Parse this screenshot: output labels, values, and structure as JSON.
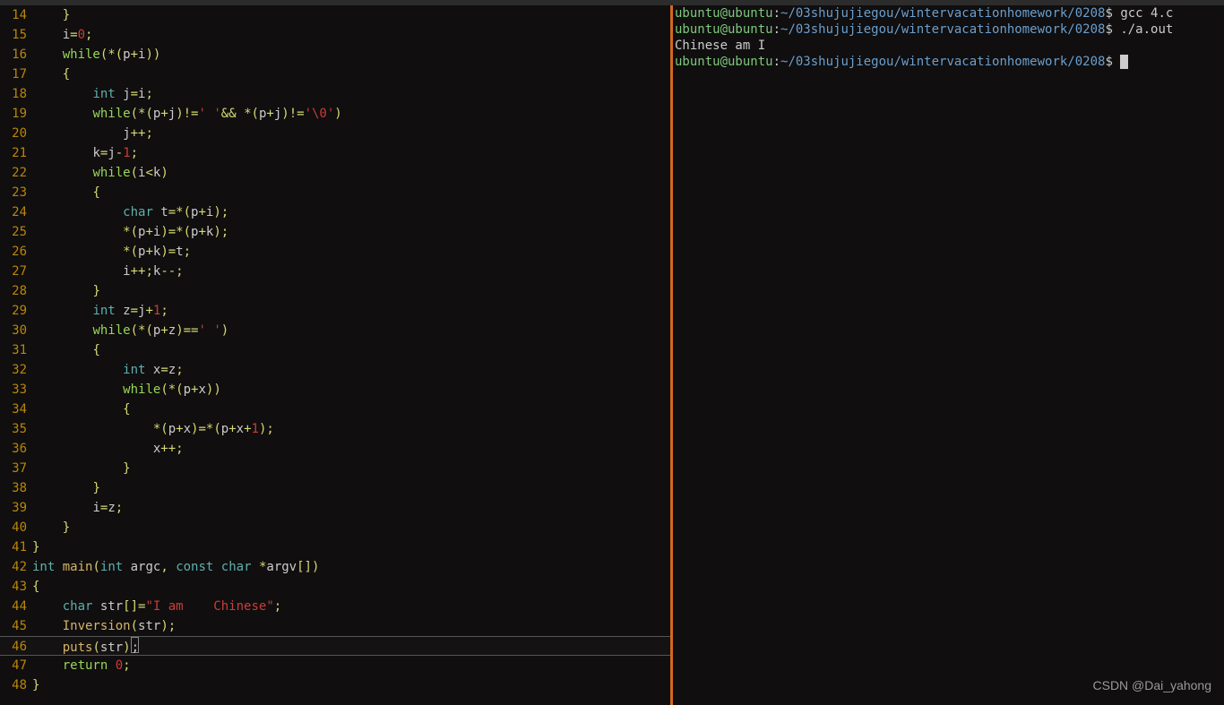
{
  "editor": {
    "lines": [
      {
        "num": 14,
        "indent": 4,
        "tokens": [
          {
            "t": "op",
            "v": "}"
          }
        ]
      },
      {
        "num": 15,
        "indent": 4,
        "tokens": [
          {
            "t": "ident",
            "v": "i"
          },
          {
            "t": "op",
            "v": "="
          },
          {
            "t": "num",
            "v": "0"
          },
          {
            "t": "op",
            "v": ";"
          }
        ]
      },
      {
        "num": 16,
        "indent": 4,
        "tokens": [
          {
            "t": "kw",
            "v": "while"
          },
          {
            "t": "op",
            "v": "(*("
          },
          {
            "t": "ident",
            "v": "p"
          },
          {
            "t": "op",
            "v": "+"
          },
          {
            "t": "ident",
            "v": "i"
          },
          {
            "t": "op",
            "v": "))"
          }
        ]
      },
      {
        "num": 17,
        "indent": 4,
        "tokens": [
          {
            "t": "op",
            "v": "{"
          }
        ]
      },
      {
        "num": 18,
        "indent": 8,
        "tokens": [
          {
            "t": "type",
            "v": "int"
          },
          {
            "t": "ident",
            "v": " j"
          },
          {
            "t": "op",
            "v": "="
          },
          {
            "t": "ident",
            "v": "i"
          },
          {
            "t": "op",
            "v": ";"
          }
        ]
      },
      {
        "num": 19,
        "indent": 8,
        "tokens": [
          {
            "t": "kw",
            "v": "while"
          },
          {
            "t": "op",
            "v": "(*("
          },
          {
            "t": "ident",
            "v": "p"
          },
          {
            "t": "op",
            "v": "+"
          },
          {
            "t": "ident",
            "v": "j"
          },
          {
            "t": "op",
            "v": ")!="
          },
          {
            "t": "str",
            "v": "' '"
          },
          {
            "t": "op",
            "v": "&& *("
          },
          {
            "t": "ident",
            "v": "p"
          },
          {
            "t": "op",
            "v": "+"
          },
          {
            "t": "ident",
            "v": "j"
          },
          {
            "t": "op",
            "v": ")!="
          },
          {
            "t": "str",
            "v": "'\\0'"
          },
          {
            "t": "op",
            "v": ")"
          }
        ]
      },
      {
        "num": 20,
        "indent": 12,
        "tokens": [
          {
            "t": "ident",
            "v": "j"
          },
          {
            "t": "op",
            "v": "++;"
          }
        ]
      },
      {
        "num": 21,
        "indent": 8,
        "tokens": [
          {
            "t": "ident",
            "v": "k"
          },
          {
            "t": "op",
            "v": "="
          },
          {
            "t": "ident",
            "v": "j"
          },
          {
            "t": "op",
            "v": "-"
          },
          {
            "t": "num",
            "v": "1"
          },
          {
            "t": "op",
            "v": ";"
          }
        ]
      },
      {
        "num": 22,
        "indent": 8,
        "tokens": [
          {
            "t": "kw",
            "v": "while"
          },
          {
            "t": "op",
            "v": "("
          },
          {
            "t": "ident",
            "v": "i"
          },
          {
            "t": "op",
            "v": "<"
          },
          {
            "t": "ident",
            "v": "k"
          },
          {
            "t": "op",
            "v": ")"
          }
        ]
      },
      {
        "num": 23,
        "indent": 8,
        "tokens": [
          {
            "t": "op",
            "v": "{"
          }
        ]
      },
      {
        "num": 24,
        "indent": 12,
        "tokens": [
          {
            "t": "type",
            "v": "char"
          },
          {
            "t": "ident",
            "v": " t"
          },
          {
            "t": "op",
            "v": "=*("
          },
          {
            "t": "ident",
            "v": "p"
          },
          {
            "t": "op",
            "v": "+"
          },
          {
            "t": "ident",
            "v": "i"
          },
          {
            "t": "op",
            "v": ");"
          }
        ]
      },
      {
        "num": 25,
        "indent": 12,
        "tokens": [
          {
            "t": "op",
            "v": "*("
          },
          {
            "t": "ident",
            "v": "p"
          },
          {
            "t": "op",
            "v": "+"
          },
          {
            "t": "ident",
            "v": "i"
          },
          {
            "t": "op",
            "v": ")=*("
          },
          {
            "t": "ident",
            "v": "p"
          },
          {
            "t": "op",
            "v": "+"
          },
          {
            "t": "ident",
            "v": "k"
          },
          {
            "t": "op",
            "v": ");"
          }
        ]
      },
      {
        "num": 26,
        "indent": 12,
        "tokens": [
          {
            "t": "op",
            "v": "*("
          },
          {
            "t": "ident",
            "v": "p"
          },
          {
            "t": "op",
            "v": "+"
          },
          {
            "t": "ident",
            "v": "k"
          },
          {
            "t": "op",
            "v": ")="
          },
          {
            "t": "ident",
            "v": "t"
          },
          {
            "t": "op",
            "v": ";"
          }
        ]
      },
      {
        "num": 27,
        "indent": 12,
        "tokens": [
          {
            "t": "ident",
            "v": "i"
          },
          {
            "t": "op",
            "v": "++;"
          },
          {
            "t": "ident",
            "v": "k"
          },
          {
            "t": "op",
            "v": "--;"
          }
        ]
      },
      {
        "num": 28,
        "indent": 8,
        "tokens": [
          {
            "t": "op",
            "v": "}"
          }
        ]
      },
      {
        "num": 29,
        "indent": 8,
        "tokens": [
          {
            "t": "type",
            "v": "int"
          },
          {
            "t": "ident",
            "v": " z"
          },
          {
            "t": "op",
            "v": "="
          },
          {
            "t": "ident",
            "v": "j"
          },
          {
            "t": "op",
            "v": "+"
          },
          {
            "t": "num",
            "v": "1"
          },
          {
            "t": "op",
            "v": ";"
          }
        ]
      },
      {
        "num": 30,
        "indent": 8,
        "tokens": [
          {
            "t": "kw",
            "v": "while"
          },
          {
            "t": "op",
            "v": "(*("
          },
          {
            "t": "ident",
            "v": "p"
          },
          {
            "t": "op",
            "v": "+"
          },
          {
            "t": "ident",
            "v": "z"
          },
          {
            "t": "op",
            "v": ")=="
          },
          {
            "t": "str",
            "v": "' '"
          },
          {
            "t": "op",
            "v": ")"
          }
        ]
      },
      {
        "num": 31,
        "indent": 8,
        "tokens": [
          {
            "t": "op",
            "v": "{"
          }
        ]
      },
      {
        "num": 32,
        "indent": 12,
        "tokens": [
          {
            "t": "type",
            "v": "int"
          },
          {
            "t": "ident",
            "v": " x"
          },
          {
            "t": "op",
            "v": "="
          },
          {
            "t": "ident",
            "v": "z"
          },
          {
            "t": "op",
            "v": ";"
          }
        ]
      },
      {
        "num": 33,
        "indent": 12,
        "tokens": [
          {
            "t": "kw",
            "v": "while"
          },
          {
            "t": "op",
            "v": "(*("
          },
          {
            "t": "ident",
            "v": "p"
          },
          {
            "t": "op",
            "v": "+"
          },
          {
            "t": "ident",
            "v": "x"
          },
          {
            "t": "op",
            "v": "))"
          }
        ]
      },
      {
        "num": 34,
        "indent": 12,
        "tokens": [
          {
            "t": "op",
            "v": "{"
          }
        ]
      },
      {
        "num": 35,
        "indent": 16,
        "tokens": [
          {
            "t": "op",
            "v": "*("
          },
          {
            "t": "ident",
            "v": "p"
          },
          {
            "t": "op",
            "v": "+"
          },
          {
            "t": "ident",
            "v": "x"
          },
          {
            "t": "op",
            "v": ")=*("
          },
          {
            "t": "ident",
            "v": "p"
          },
          {
            "t": "op",
            "v": "+"
          },
          {
            "t": "ident",
            "v": "x"
          },
          {
            "t": "op",
            "v": "+"
          },
          {
            "t": "num",
            "v": "1"
          },
          {
            "t": "op",
            "v": ");"
          }
        ]
      },
      {
        "num": 36,
        "indent": 16,
        "tokens": [
          {
            "t": "ident",
            "v": "x"
          },
          {
            "t": "op",
            "v": "++;"
          }
        ]
      },
      {
        "num": 37,
        "indent": 12,
        "tokens": [
          {
            "t": "op",
            "v": "}"
          }
        ]
      },
      {
        "num": 38,
        "indent": 8,
        "tokens": [
          {
            "t": "op",
            "v": "}"
          }
        ]
      },
      {
        "num": 39,
        "indent": 8,
        "tokens": [
          {
            "t": "ident",
            "v": "i"
          },
          {
            "t": "op",
            "v": "="
          },
          {
            "t": "ident",
            "v": "z"
          },
          {
            "t": "op",
            "v": ";"
          }
        ]
      },
      {
        "num": 40,
        "indent": 4,
        "tokens": [
          {
            "t": "op",
            "v": "}"
          }
        ]
      },
      {
        "num": 41,
        "indent": 0,
        "tokens": [
          {
            "t": "op",
            "v": "}"
          }
        ]
      },
      {
        "num": 42,
        "indent": 0,
        "tokens": [
          {
            "t": "type",
            "v": "int"
          },
          {
            "t": "ident",
            "v": " "
          },
          {
            "t": "func",
            "v": "main"
          },
          {
            "t": "op",
            "v": "("
          },
          {
            "t": "type",
            "v": "int"
          },
          {
            "t": "ident",
            "v": " argc"
          },
          {
            "t": "op",
            "v": ", "
          },
          {
            "t": "type",
            "v": "const"
          },
          {
            "t": "ident",
            "v": " "
          },
          {
            "t": "type",
            "v": "char"
          },
          {
            "t": "ident",
            "v": " "
          },
          {
            "t": "op",
            "v": "*"
          },
          {
            "t": "ident",
            "v": "argv"
          },
          {
            "t": "op",
            "v": "[])"
          }
        ]
      },
      {
        "num": 43,
        "indent": 0,
        "tokens": [
          {
            "t": "op",
            "v": "{"
          }
        ]
      },
      {
        "num": 44,
        "indent": 4,
        "tokens": [
          {
            "t": "type",
            "v": "char"
          },
          {
            "t": "ident",
            "v": " str"
          },
          {
            "t": "op",
            "v": "[]="
          },
          {
            "t": "str",
            "v": "\"I am    Chinese\""
          },
          {
            "t": "op",
            "v": ";"
          }
        ]
      },
      {
        "num": 45,
        "indent": 4,
        "tokens": [
          {
            "t": "func",
            "v": "Inversion"
          },
          {
            "t": "op",
            "v": "("
          },
          {
            "t": "ident",
            "v": "str"
          },
          {
            "t": "op",
            "v": ");"
          }
        ]
      },
      {
        "num": 46,
        "indent": 4,
        "tokens": [
          {
            "t": "func",
            "v": "puts"
          },
          {
            "t": "op",
            "v": "("
          },
          {
            "t": "ident",
            "v": "str"
          },
          {
            "t": "op",
            "v": ")"
          },
          {
            "t": "cursor",
            "v": ";"
          }
        ],
        "current": true
      },
      {
        "num": 47,
        "indent": 4,
        "tokens": [
          {
            "t": "kw",
            "v": "return"
          },
          {
            "t": "ident",
            "v": " "
          },
          {
            "t": "num",
            "v": "0"
          },
          {
            "t": "op",
            "v": ";"
          }
        ]
      },
      {
        "num": 48,
        "indent": 0,
        "tokens": [
          {
            "t": "op",
            "v": "}"
          }
        ]
      }
    ]
  },
  "terminal": {
    "prompt_user": "ubuntu@ubuntu",
    "prompt_sep": ":",
    "prompt_path": "~/03shujujiegou/wintervacationhomework/0208",
    "prompt_end": "$",
    "lines": [
      {
        "type": "cmd",
        "cmd": "gcc 4.c"
      },
      {
        "type": "cmd",
        "cmd": "./a.out"
      },
      {
        "type": "out",
        "text": "Chinese am I"
      },
      {
        "type": "cmd",
        "cmd": "",
        "cursor": true
      }
    ]
  },
  "watermark": "CSDN @Dai_yahong"
}
